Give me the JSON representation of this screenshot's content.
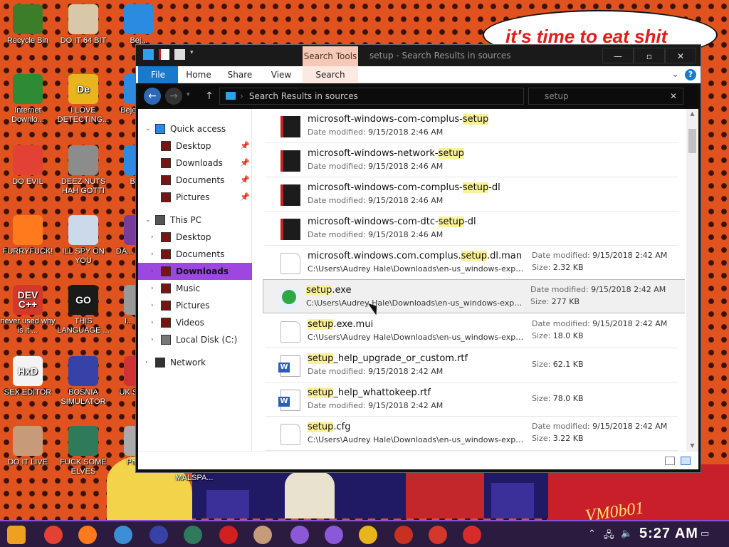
{
  "desktop": {
    "speech_text": "it's time to eat shit",
    "watermark": "VM0b01",
    "icons": [
      {
        "label": "Recycle Bin",
        "color": "#3c7d2a"
      },
      {
        "label": "DO IT 64 BIT",
        "color": "#d8c7a8"
      },
      {
        "label": "Bej...",
        "color": "#2b8be0"
      },
      {
        "label": "Internet Downlo...",
        "color": "#2f8a35"
      },
      {
        "label": "I LOVE DETECTING...",
        "color": "#e8b51c",
        "glyph": "De"
      },
      {
        "label": "Beje... D...",
        "color": "#2b8be0"
      },
      {
        "label": "DO EVIL",
        "color": "#e34133"
      },
      {
        "label": "DEEZ NUTS HAH GOTTI",
        "color": "#8c8c8c"
      },
      {
        "label": "Bej...",
        "color": "#2b8be0"
      },
      {
        "label": "FURRYFUCK!",
        "color": "#ff7a1c"
      },
      {
        "label": "ILL SPY ON YOU",
        "color": "#cbd9ea"
      },
      {
        "label": "DA... SIMU...",
        "color": "#7a3c9c"
      },
      {
        "label": "never used why is it ...",
        "color": "#d4382a",
        "glyph": "DEV C++"
      },
      {
        "label": "THIS LANGUAGE ...",
        "color": "#1a1a1a",
        "glyph": "GO"
      },
      {
        "label": "I... CH...",
        "color": "#999999"
      },
      {
        "label": "SEX EDITOR",
        "color": "#f4f4f4",
        "glyph": "HxD"
      },
      {
        "label": "BOSNIA SIMULATOR",
        "color": "#3742a8"
      },
      {
        "label": "UK SIMU...",
        "color": "#cc3333"
      },
      {
        "label": "DO IT LIVE",
        "color": "#c79a7a"
      },
      {
        "label": "FUCK SOME ELVES",
        "color": "#2e7a5a"
      },
      {
        "label": "Pegg...",
        "color": "#aaaaaa"
      },
      {
        "label": "MALSPA...",
        "color": "#444444"
      }
    ]
  },
  "explorer": {
    "title": "setup - Search Results in sources",
    "context_tab": "Search Tools",
    "window_buttons": [
      "—",
      "▫",
      "✕"
    ],
    "ribbon_tabs": [
      "File",
      "Home",
      "Share",
      "View",
      "Search"
    ],
    "address": "Search Results in sources",
    "search_value": "setup",
    "nav": {
      "quick_access": "Quick access",
      "quick_items": [
        "Desktop",
        "Downloads",
        "Documents",
        "Pictures"
      ],
      "this_pc": "This PC",
      "pc_items": [
        "Desktop",
        "Documents",
        "Downloads",
        "Music",
        "Pictures",
        "Videos",
        "Local Disk (C:)"
      ],
      "selected": "Downloads",
      "network": "Network"
    },
    "date_label": "Date modified:",
    "size_label": "Size:",
    "results": [
      {
        "pre": "microsoft-windows-com-complus-",
        "hl": "setup",
        "post": "",
        "icon": "exec",
        "date": "9/15/2018 2:46 AM"
      },
      {
        "pre": "microsoft-windows-network-",
        "hl": "setup",
        "post": "",
        "icon": "exec",
        "date": "9/15/2018 2:46 AM"
      },
      {
        "pre": "microsoft-windows-com-complus-",
        "hl": "setup",
        "post": "-dl",
        "icon": "exec",
        "date": "9/15/2018 2:46 AM"
      },
      {
        "pre": "microsoft-windows-com-dtc-",
        "hl": "setup",
        "post": "-dl",
        "icon": "exec",
        "date": "9/15/2018 2:46 AM"
      },
      {
        "pre": "microsoft.windows.com.complus.",
        "hl": "setup",
        "post": ".dl.man",
        "icon": "doc",
        "path": "C:\\Users\\Audrey Hale\\Downloads\\en-us_windows-experien...",
        "date": "9/15/2018 2:42 AM",
        "size": "2.32 KB"
      },
      {
        "pre": "",
        "hl": "setup",
        "post": ".exe",
        "icon": "setup",
        "path": "C:\\Users\\Audrey Hale\\Downloads\\en-us_windows-experien...",
        "date": "9/15/2018 2:42 AM",
        "size": "277 KB",
        "hover": true
      },
      {
        "pre": "",
        "hl": "setup",
        "post": ".exe.mui",
        "icon": "doc",
        "path": "C:\\Users\\Audrey Hale\\Downloads\\en-us_windows-experien...",
        "date": "9/15/2018 2:42 AM",
        "size": "18.0 KB"
      },
      {
        "pre": "",
        "hl": "setup",
        "post": "_help_upgrade_or_custom.rtf",
        "icon": "word",
        "date": "9/15/2018 2:42 AM",
        "size": "62.1 KB"
      },
      {
        "pre": "",
        "hl": "setup",
        "post": "_help_whattokeep.rtf",
        "icon": "word",
        "date": "9/15/2018 2:42 AM",
        "size": "78.0 KB"
      },
      {
        "pre": "",
        "hl": "setup",
        "post": ".cfg",
        "icon": "doc",
        "path": "C:\\Users\\Audrey Hale\\Downloads\\en-us_windows-experien...",
        "date": "9/15/2018 2:42 AM",
        "size": "3.22 KB"
      }
    ]
  },
  "taskbar": {
    "apps": [
      "#f0a020",
      "#e34133",
      "#ff7a1c",
      "#3b8fd6",
      "#3742a8",
      "#2e7a5a",
      "#d21f1f",
      "#c79a7a",
      "#8b58d8",
      "#8b58d8",
      "#e8b51c",
      "#c83020",
      "#d4382a",
      "#d82b2b"
    ],
    "clock": "5:27 AM"
  }
}
